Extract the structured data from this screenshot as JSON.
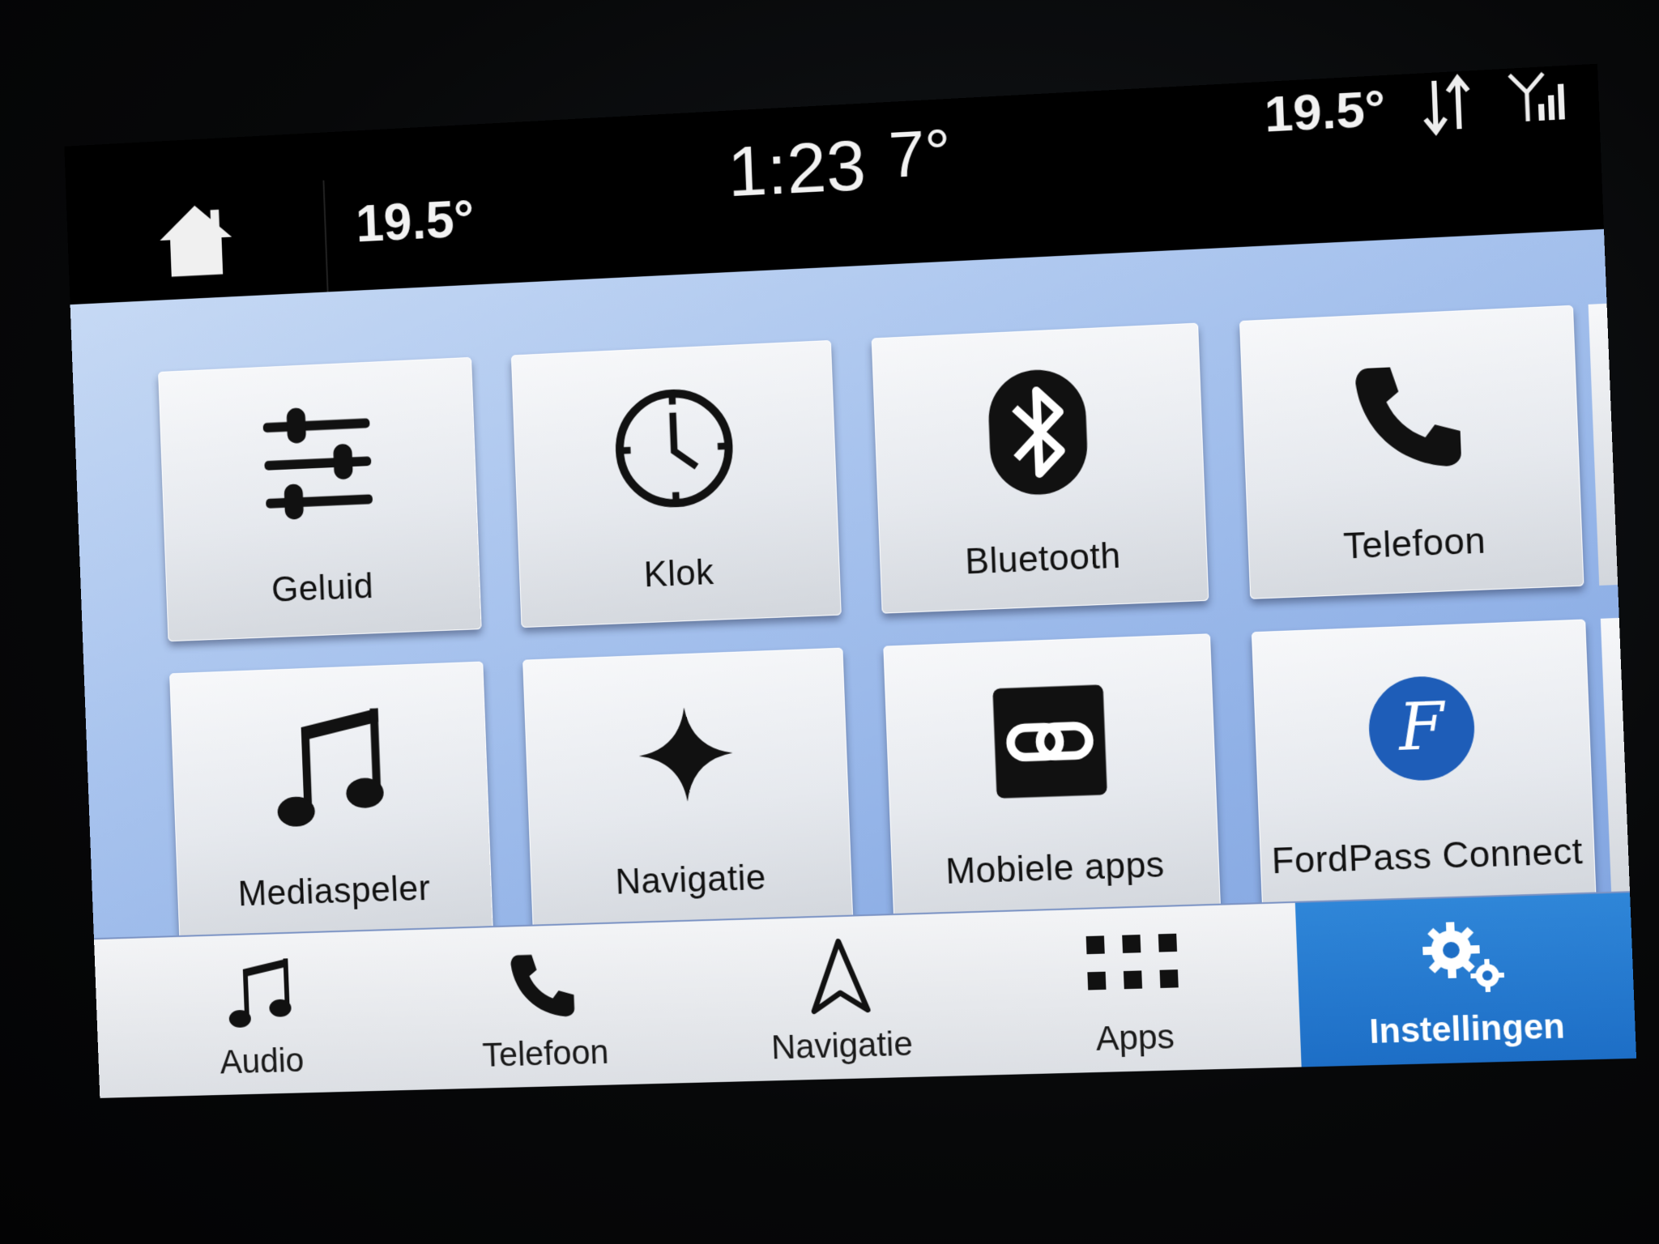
{
  "status_bar": {
    "temp_left": "19.5°",
    "clock": "1:23",
    "outside_temp": "7°",
    "temp_right": "19.5°"
  },
  "tiles": [
    {
      "label": "Geluid",
      "icon": "sliders-icon"
    },
    {
      "label": "Klok",
      "icon": "clock-icon"
    },
    {
      "label": "Bluetooth",
      "icon": "bluetooth-icon"
    },
    {
      "label": "Telefoon",
      "icon": "phone-icon"
    },
    {
      "label": "Mediaspeler",
      "icon": "music-note-icon"
    },
    {
      "label": "Navigatie",
      "icon": "star-compass-icon"
    },
    {
      "label": "Mobiele apps",
      "icon": "link-icon"
    },
    {
      "label": "FordPass Connect",
      "icon": "fordpass-logo-icon"
    }
  ],
  "pager": {
    "pages": 2,
    "current": 1
  },
  "nav": [
    {
      "label": "Audio",
      "icon": "music-note-icon"
    },
    {
      "label": "Telefoon",
      "icon": "phone-icon"
    },
    {
      "label": "Navigatie",
      "icon": "navigation-arrow-icon"
    },
    {
      "label": "Apps",
      "icon": "apps-grid-icon"
    },
    {
      "label": "Instellingen",
      "icon": "gears-icon",
      "active": true
    }
  ],
  "colors": {
    "accent": "#2d6be0",
    "active_nav": "#1d6ec6",
    "content_bg": "#a9c4ee"
  }
}
